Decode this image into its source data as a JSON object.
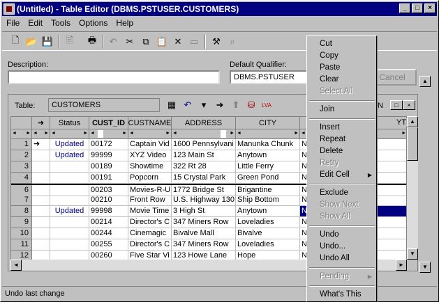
{
  "window": {
    "title": "(Untitled) - Table Editor (DBMS.PSTUSER.CUSTOMERS)"
  },
  "menu": [
    "File",
    "Edit",
    "Tools",
    "Options",
    "Help"
  ],
  "form": {
    "description_label": "Description:",
    "description_value": "",
    "qualifier_label": "Default Qualifier:",
    "qualifier_value": "DBMS.PSTUSER",
    "cancel_label": "Cancel",
    "table_label": "Table:",
    "table_value": "CUSTOMERS",
    "right_partial": "N",
    "ytd_partial": "YTD"
  },
  "grid": {
    "headers": [
      "",
      "➜",
      "Status",
      "CUST_ID",
      "CUSTNAME",
      "ADDRESS",
      "CITY",
      ""
    ],
    "rows": [
      {
        "n": "1",
        "arrow": "➜",
        "status": "Updated",
        "id": "00172",
        "name": "Captain Vid",
        "addr": "1600 Pennsylvani",
        "city": "Manunka Chunk",
        "st": "N"
      },
      {
        "n": "2",
        "arrow": "",
        "status": "Updated",
        "id": "99999",
        "name": "XYZ Video",
        "addr": "123 Main St",
        "city": "Anytown",
        "st": "N"
      },
      {
        "n": "3",
        "arrow": "",
        "status": "",
        "id": "00189",
        "name": "Showtime",
        "addr": "322 Rt 28",
        "city": "Little Ferry",
        "st": "N"
      },
      {
        "n": "4",
        "arrow": "",
        "status": "",
        "id": "00191",
        "name": "Popcorn",
        "addr": "15 Crystal Park",
        "city": "Green Pond",
        "st": "N"
      },
      {
        "n": "6",
        "arrow": "",
        "status": "",
        "id": "00203",
        "name": "Movies-R-U",
        "addr": "1772 Bridge St",
        "city": "Brigantine",
        "st": "N"
      },
      {
        "n": "7",
        "arrow": "",
        "status": "",
        "id": "00210",
        "name": "Front Row",
        "addr": "U.S. Highway 130",
        "city": "Ship Bottom",
        "st": "N"
      },
      {
        "n": "8",
        "arrow": "",
        "status": "Updated",
        "id": "99998",
        "name": "Movie Time",
        "addr": "3 High St",
        "city": "Anytown",
        "st": "N"
      },
      {
        "n": "9",
        "arrow": "",
        "status": "",
        "id": "00214",
        "name": "Director's C",
        "addr": "347 Miners Row",
        "city": "Loveladies",
        "st": "N"
      },
      {
        "n": "10",
        "arrow": "",
        "status": "",
        "id": "00244",
        "name": "Cinemagic",
        "addr": "Bivalve Mall",
        "city": "Bivalve",
        "st": "N"
      },
      {
        "n": "11",
        "arrow": "",
        "status": "",
        "id": "00255",
        "name": "Director's C",
        "addr": "347 Miners Row",
        "city": "Loveladies",
        "st": "N"
      },
      {
        "n": "12",
        "arrow": "",
        "status": "",
        "id": "00260",
        "name": "Five Star Vi",
        "addr": "123 Howe Lane",
        "city": "Hope",
        "st": "N"
      }
    ]
  },
  "context_menu": {
    "cut": "Cut",
    "copy": "Copy",
    "paste": "Paste",
    "clear": "Clear",
    "select_all": "Select All",
    "join": "Join",
    "insert": "Insert",
    "repeat": "Repeat",
    "delete": "Delete",
    "retry": "Retry",
    "edit_cell": "Edit Cell",
    "exclude": "Exclude",
    "show_next": "Show Next",
    "show_all": "Show All",
    "undo": "Undo",
    "undo_dots": "Undo...",
    "undo_all": "Undo All",
    "pending": "Pending",
    "whats_this": "What's This"
  },
  "status": {
    "text": "Undo last change"
  }
}
